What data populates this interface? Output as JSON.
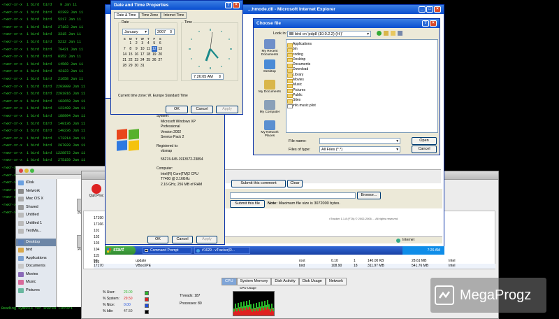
{
  "terminal": {
    "lines": [
      "-rwxr-xr-x  1 bird  bird    9 Jan 11",
      "-rwxr-xr-x  1 bird  bird   62393 Jan 11",
      "-rwxr-xr-x  1 bird  bird   5217 Jan 11",
      "-rwxr-xr-x  1 bird  bird   27163 Jan 11",
      "-rwxr-xr-x  1 bird  bird   3315 Jan 11",
      "-rwxr-xr-x  1 bird  bird   5212 Jan 11",
      "-rwxr-xr-x  1 bird  bird   79421 Jan 11",
      "-rwxr-xr-x  1 bird  bird   8352 Jan 11",
      "-rwxr-xr-x  1 bird  bird   14569 Jan 11",
      "-rwxr-xr-x  1 bird  bird   42123 Jan 11",
      "-rwxr-xr-x  1 bird  bird   21658 Jan 11",
      "-rwxr-xr-x  1 bird  bird  2203009 Jan 11",
      "-rwxr-xr-x  1 bird  bird  2201016 Jan 11",
      "-rwxr-xr-x  1 bird  bird   182659 Jan 11",
      "-rwxr-xr-x  1 bird  bird   123499 Jan 11",
      "-rwxr-xr-x  1 bird  bird   188994 Jan 11",
      "-rwxr-xr-x  1 bird  bird   140136 Jan 11",
      "-rwxr-xr-x  1 bird  bird   140236 Jan 11",
      "-rwxr-xr-x  1 bird  bird   173214 Jan 11",
      "-rwxr-xr-x  1 bird  bird   207029 Jan 11",
      "-rwxr-xr-x  1 bird  bird  1228872 Jan 11",
      "-rwxr-xr-x  1 bird  bird   275159 Jan 11",
      "-rwxr-xr-x  1 bird  bird  5161816 Jan 11",
      "-rwxr-xr-x  1 bird  bird   207018 Jan 11",
      "-rwxr-xr-x  1 bird  bird   200528 Jan 11",
      "-rwxr-xr-x  1 bird  bird   207029 Jan 11",
      "-rwxr-xr-x  1 bird  bird     5 Jan 11",
      "-rwxr-xr-x  1 bird  bird    16 Jan 11",
      "-rwxr-xr-x  1 bird  bird",
      "",
      "",
      "",
      "",
      "",
      "",
      "",
      "",
      "",
      "",
      "",
      "",
      "Reading symbols for shared librari"
    ]
  },
  "datetime": {
    "title": "Date and Time Properties",
    "tabs": [
      "Date & Time",
      "Time Zone",
      "Internet Time"
    ],
    "date_label": "Date",
    "time_label": "Time",
    "month": "January",
    "year": "2007",
    "weekdays": [
      "S",
      "M",
      "T",
      "W",
      "T",
      "F",
      "S"
    ],
    "weeks": [
      [
        "",
        "1",
        "2",
        "3",
        "4",
        "5",
        "6"
      ],
      [
        "7",
        "8",
        "9",
        "10",
        "11",
        "12",
        "13"
      ],
      [
        "14",
        "15",
        "16",
        "17",
        "18",
        "19",
        "20"
      ],
      [
        "21",
        "22",
        "23",
        "24",
        "25",
        "26",
        "27"
      ],
      [
        "28",
        "29",
        "30",
        "31",
        "",
        "",
        ""
      ]
    ],
    "selected_day": "12",
    "time_value": "7:26:05 AM",
    "timezone": "Current time zone:  W. Europe Standard Time",
    "ok": "OK",
    "cancel": "Cancel",
    "apply": "Apply"
  },
  "ie": {
    "title": "...hmode.dll - Microsoft Internet Explorer",
    "submit_comment": "Submit this comment",
    "clear": "Clear",
    "browse": "Browse...",
    "submit_file": "Submit this file",
    "note_label": "Note:",
    "note_text": "Maximum file size is 3072000 bytes.",
    "footer": "vTracker 1.1.8 (FTA) © 2002-2006 ... All rights reserved",
    "status": "Internet"
  },
  "sysprops": {
    "system_label": "System:",
    "system_lines": [
      "Microsoft Windows XP",
      "Professional",
      "Version 2002",
      "Service Pack 2"
    ],
    "registered_label": "Registered to:",
    "registered_to": "vbsnap",
    "product_id": "55274-645-1913572-23894",
    "computer_label": "Computer:",
    "computer_lines": [
      "Intel(R) Core(TM)2 CPU",
      "T7400  @ 2.16GHz",
      "2.16 GHz, 256 MB of RAM"
    ],
    "ok": "OK",
    "cancel": "Cancel",
    "apply": "Apply"
  },
  "choose_file": {
    "title": "Choose file",
    "look_in_label": "Look in:",
    "look_in_value": "bird on 'pdp8 (10.0.2.2) (H:)'",
    "places": [
      "My Recent Documents",
      "Desktop",
      "My Documents",
      "My Computer",
      "My Network Places"
    ],
    "items": [
      {
        "name": "Applications",
        "file": false
      },
      {
        "name": "bin",
        "file": false
      },
      {
        "name": "coding",
        "file": false
      },
      {
        "name": "Desktop",
        "file": false
      },
      {
        "name": "Documents",
        "file": false
      },
      {
        "name": "Download",
        "file": false
      },
      {
        "name": "Library",
        "file": false
      },
      {
        "name": "Movies",
        "file": false
      },
      {
        "name": "Music",
        "file": false
      },
      {
        "name": "Pictures",
        "file": false
      },
      {
        "name": "Public",
        "file": false
      },
      {
        "name": "Sites",
        "file": false
      },
      {
        "name": "info.music.plist",
        "file": true
      }
    ],
    "file_name_label": "File name:",
    "file_name_value": "",
    "files_of_type_label": "Files of type:",
    "files_of_type_value": "All Files (*.*)",
    "open": "Open",
    "cancel": "Cancel"
  },
  "finder": {
    "sidebar": [
      "iDisk",
      "Network",
      "Mac OS X",
      "Shared",
      "Untitled",
      "Untitled 1",
      "TextMa...",
      "Desktop",
      "bird",
      "Applications",
      "Documents",
      "Movies",
      "Music",
      "Pictures"
    ],
    "selected": "Desktop",
    "items": [
      "Picture",
      "Picture"
    ],
    "quit_label": "Quit Proc"
  },
  "taskbar": {
    "start": "start",
    "tasks": [
      "Command Prompt",
      "#1629 - vTracker(R..."
    ],
    "clock": "7:26 AM"
  },
  "activity": {
    "rows": [
      {
        "pid": "50",
        "name": "update",
        "user": "root",
        "cpu": "0.10",
        "threads": "1",
        "real": "140.00 KB",
        "virtual": "28.61 MB",
        "kind": "Intel"
      },
      {
        "pid": "17170",
        "name": "VBoxXPE",
        "user": "bird",
        "cpu": "108.90",
        "threads": "18",
        "real": "311.97 MB",
        "virtual": "541.76 MB",
        "kind": "Intel"
      }
    ],
    "pid_fragments": [
      "17190",
      "17166",
      "101",
      "102",
      "103",
      "104",
      "115",
      "126"
    ],
    "tabs": [
      "CPU",
      "System Memory",
      "Disk Activity",
      "Disk Usage",
      "Network"
    ],
    "selected_tab": "CPU",
    "stats": [
      {
        "label": "% User:",
        "value": "23.00",
        "color": "#2ab82a"
      },
      {
        "label": "% System:",
        "value": "29.50",
        "color": "#e02020"
      },
      {
        "label": "% Nice:",
        "value": "0.00",
        "color": "#2050e0"
      },
      {
        "label": "% Idle:",
        "value": "47.50",
        "color": "#000000"
      }
    ],
    "threads_label": "Threads:",
    "threads_value": "187",
    "processes_label": "Processes:",
    "processes_value": "80",
    "cpu_usage_label": "CPU Usage"
  },
  "watermark": {
    "text": "MegaProgz"
  }
}
